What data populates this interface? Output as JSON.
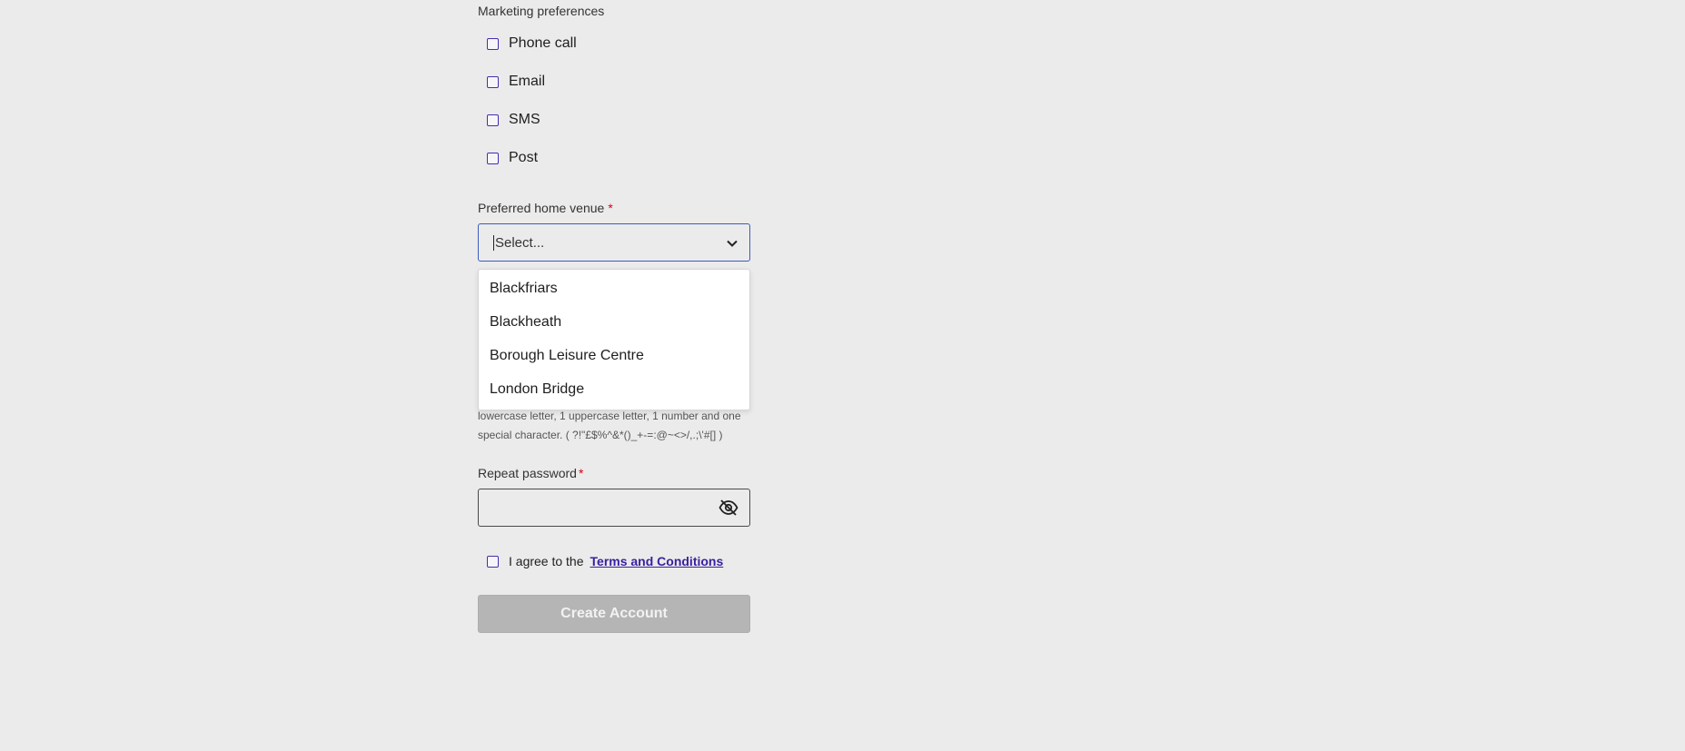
{
  "marketing": {
    "label": "Marketing preferences",
    "options": [
      "Phone call",
      "Email",
      "SMS",
      "Post"
    ]
  },
  "venue": {
    "label": "Preferred home venue",
    "required_mark": "*",
    "placeholder": "Select...",
    "options": [
      "Blackfriars",
      "Blackheath",
      "Borough Leisure Centre",
      "London Bridge"
    ]
  },
  "password_hint": {
    "line1": "lowercase letter, 1 uppercase letter, 1 number and one",
    "line2": "special character. ( ?!\"£$%^&*()_+-=:@~<>/,.;\\'#[] )"
  },
  "repeat_password": {
    "label": "Repeat password",
    "required_mark": "*",
    "visibility_icon": "eye-off-icon"
  },
  "terms": {
    "prefix": "I agree to the",
    "link": "Terms and Conditions"
  },
  "submit": {
    "label": "Create Account"
  },
  "colors": {
    "background": "#ebebeb",
    "checkbox_border": "#4a2bb0",
    "focus_border": "#3b5bc0",
    "link": "#3a1fa0",
    "required": "#d0021b",
    "button_disabled": "#b5b5b5"
  }
}
